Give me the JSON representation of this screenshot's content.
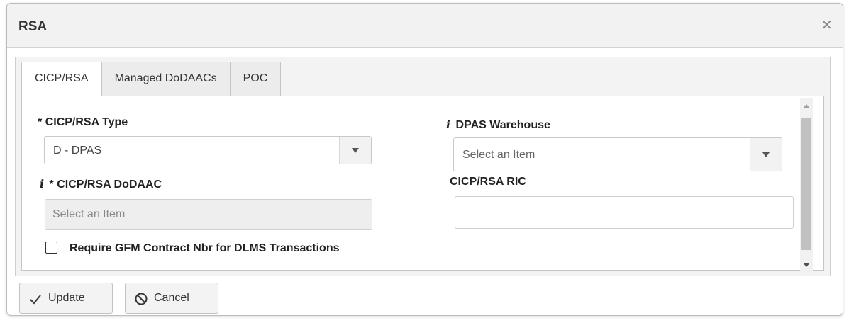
{
  "dialog": {
    "title": "RSA",
    "close_glyph": "✕"
  },
  "tabs": [
    {
      "label": "CICP/RSA",
      "active": true
    },
    {
      "label": "Managed DoDAACs",
      "active": false
    },
    {
      "label": "POC",
      "active": false
    }
  ],
  "form": {
    "rsa_type": {
      "label": "CICP/RSA Type",
      "required_mark": "*",
      "value": "D - DPAS"
    },
    "rsa_dodaac": {
      "label": "CICP/RSA DoDAAC",
      "required_mark": "*",
      "info_mark": "i",
      "placeholder": "Select an Item"
    },
    "dpas_warehouse": {
      "label": "DPAS Warehouse",
      "info_mark": "i",
      "placeholder": "Select an Item"
    },
    "rsa_ric": {
      "label": "CICP/RSA RIC",
      "value": ""
    },
    "gfm_checkbox": {
      "label": "Require GFM Contract Nbr for DLMS Transactions",
      "checked": false
    }
  },
  "buttons": {
    "update": {
      "label": "Update",
      "icon": "check-icon"
    },
    "cancel": {
      "label": "Cancel",
      "icon": "cancel-circle-icon"
    }
  }
}
